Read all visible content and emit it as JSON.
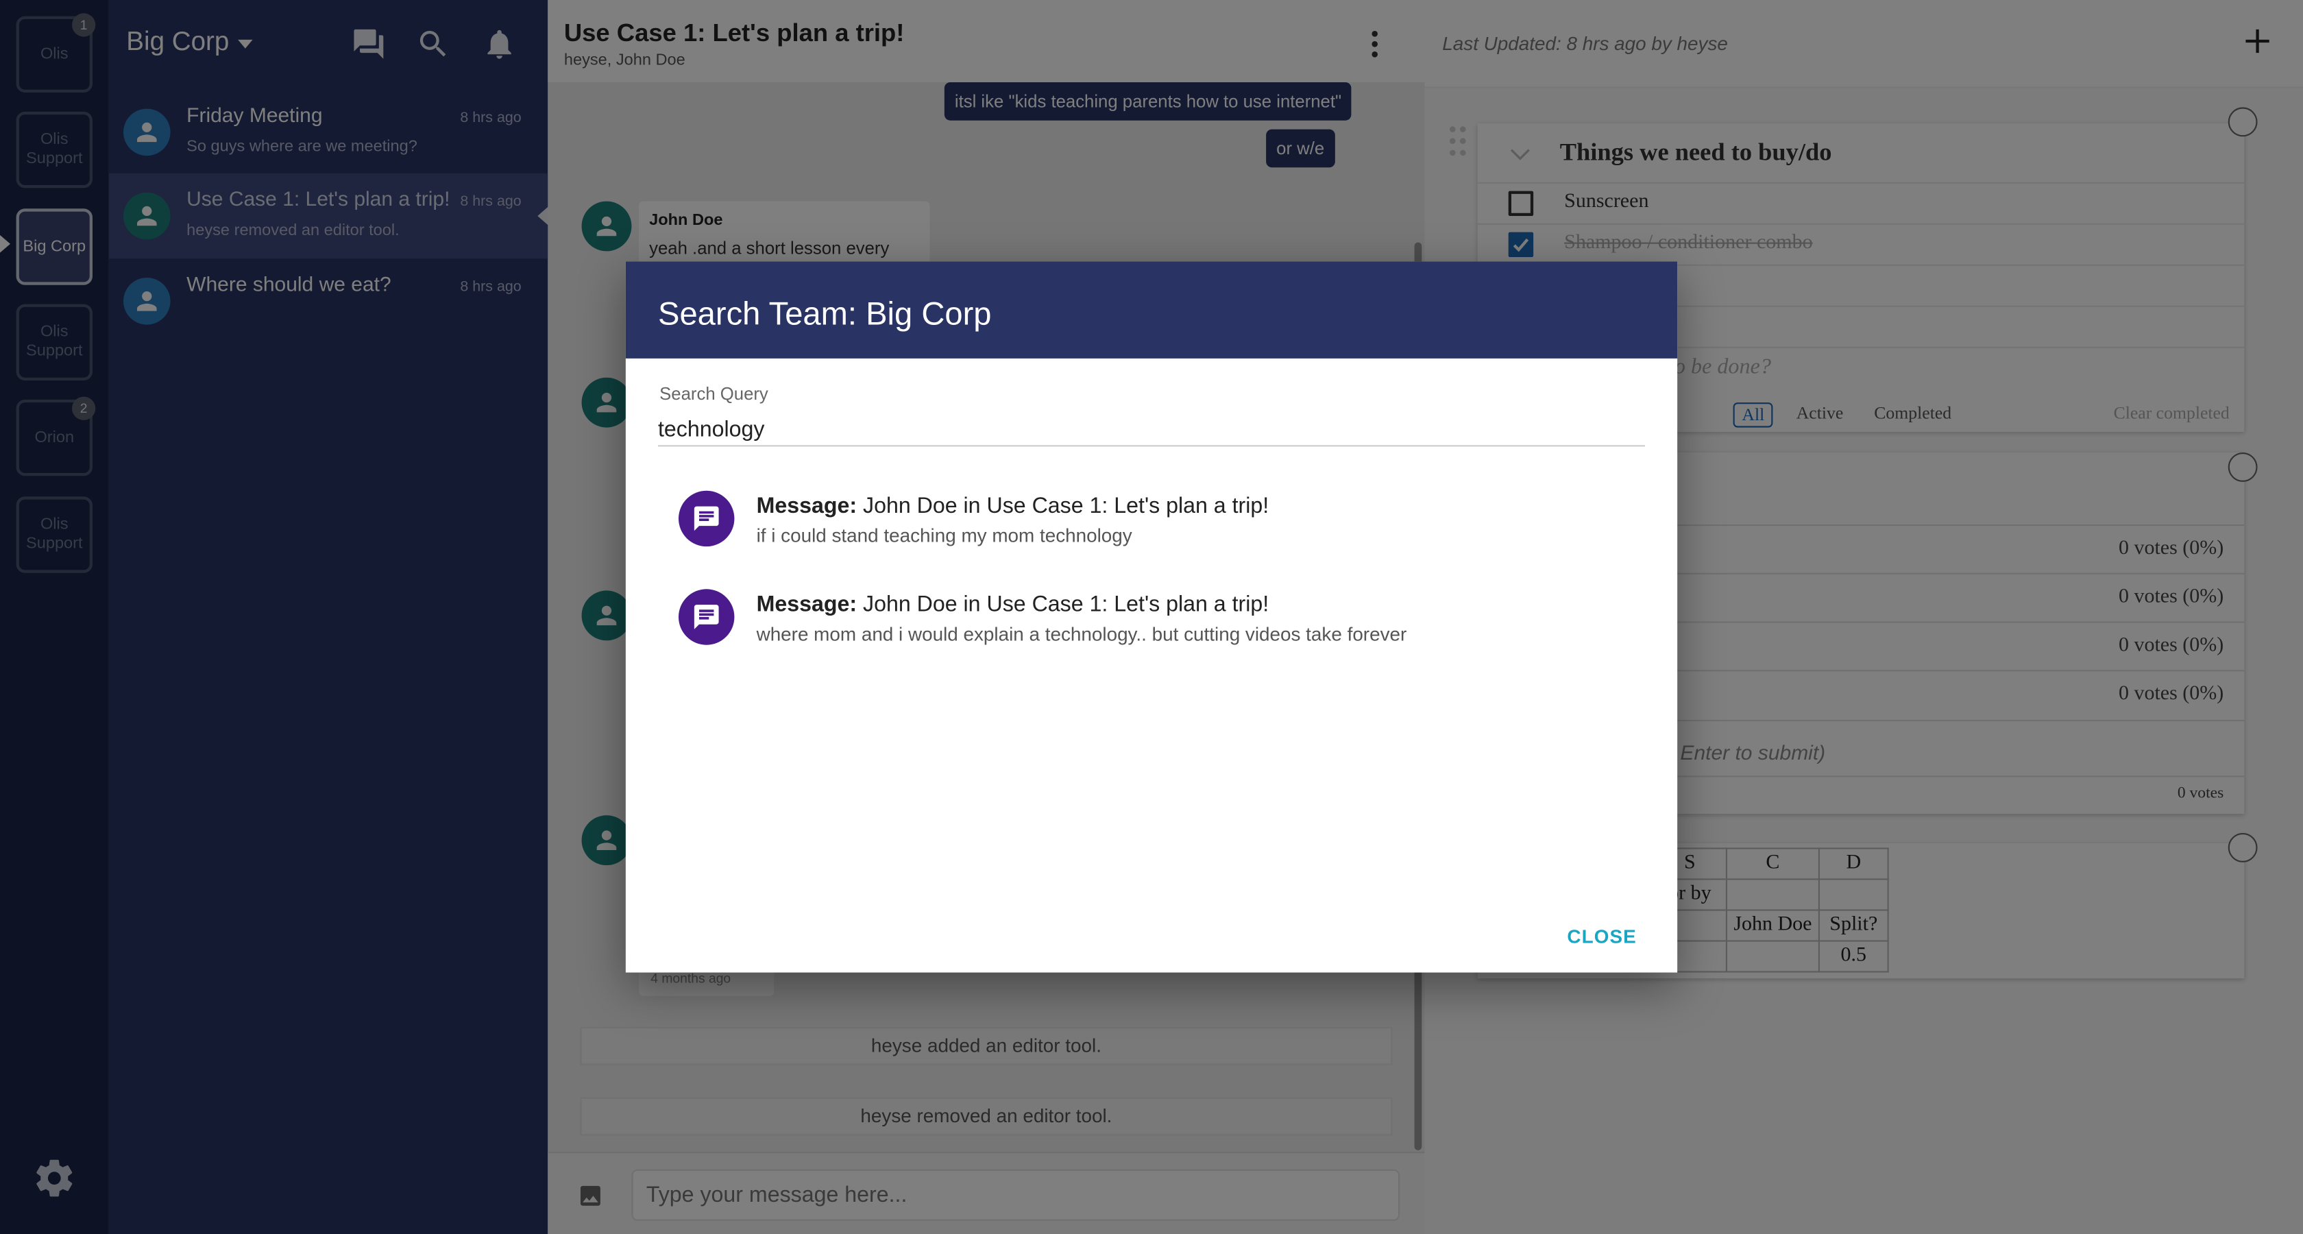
{
  "rail": {
    "teams": [
      {
        "label": "Olis",
        "badge": "1"
      },
      {
        "label": "Olis Support",
        "badge": ""
      },
      {
        "label": "Big Corp",
        "badge": "",
        "active": true
      },
      {
        "label": "Olis Support",
        "badge": ""
      },
      {
        "label": "Orion",
        "badge": "2"
      },
      {
        "label": "Olis Support",
        "badge": ""
      }
    ]
  },
  "sidebar": {
    "team_name": "Big Corp",
    "channels": [
      {
        "name": "Friday Meeting",
        "preview": "So guys where are we meeting?",
        "time": "8 hrs ago"
      },
      {
        "name": "Use Case 1: Let's plan a trip!",
        "preview": "heyse removed an editor tool.",
        "time": "8 hrs ago"
      },
      {
        "name": "Where should we eat?",
        "preview": "",
        "time": "8 hrs ago"
      }
    ]
  },
  "chat": {
    "title": "Use Case 1: Let's plan a trip!",
    "members": "heyse, John Doe",
    "messages": {
      "bubble1": "itsl ike \"kids teaching parents how to use internet\"",
      "bubble2": "or w/e",
      "author": "John Doe",
      "text": "yeah .and a short lesson every week",
      "timestamp": "4 months ago"
    },
    "system": [
      "heyse added an editor tool.",
      "heyse removed an editor tool."
    ],
    "composer_placeholder": "Type your message here..."
  },
  "tools": {
    "last_updated": "Last Updated: 8 hrs ago by heyse",
    "todo": {
      "title": "Things we need to buy/do",
      "items": [
        {
          "text": "Sunscreen",
          "done": false
        },
        {
          "text": "Shampoo / conditioner combo",
          "done": true
        }
      ],
      "new_placeholder": "o be done?",
      "filters": [
        "All",
        "Active",
        "Completed"
      ],
      "clear": "Clear completed"
    },
    "poll": {
      "votes": [
        "0 votes (0%)",
        "0 votes (0%)",
        "0 votes (0%)",
        "0 votes (0%)"
      ],
      "input_hint": "Enter to submit)",
      "total": "0 votes"
    },
    "sheet": {
      "headers": [
        "S",
        "C",
        "D"
      ],
      "r1c1": "or by",
      "r2c2": "John Doe",
      "r2c3": "Split?",
      "r3c3": "0.5"
    }
  },
  "dialog": {
    "title": "Search Team: Big Corp",
    "query_label": "Search Query",
    "query_value": "technology",
    "results": [
      {
        "prefix": "Message:",
        "title": " John Doe in Use Case 1: Let's plan a trip!",
        "snippet": "if i could stand teaching my mom technology"
      },
      {
        "prefix": "Message:",
        "title": " John Doe in Use Case 1: Let's plan a trip!",
        "snippet": "where mom and i would explain a technology.. but cutting videos take forever"
      }
    ],
    "close_label": "CLOSE"
  }
}
